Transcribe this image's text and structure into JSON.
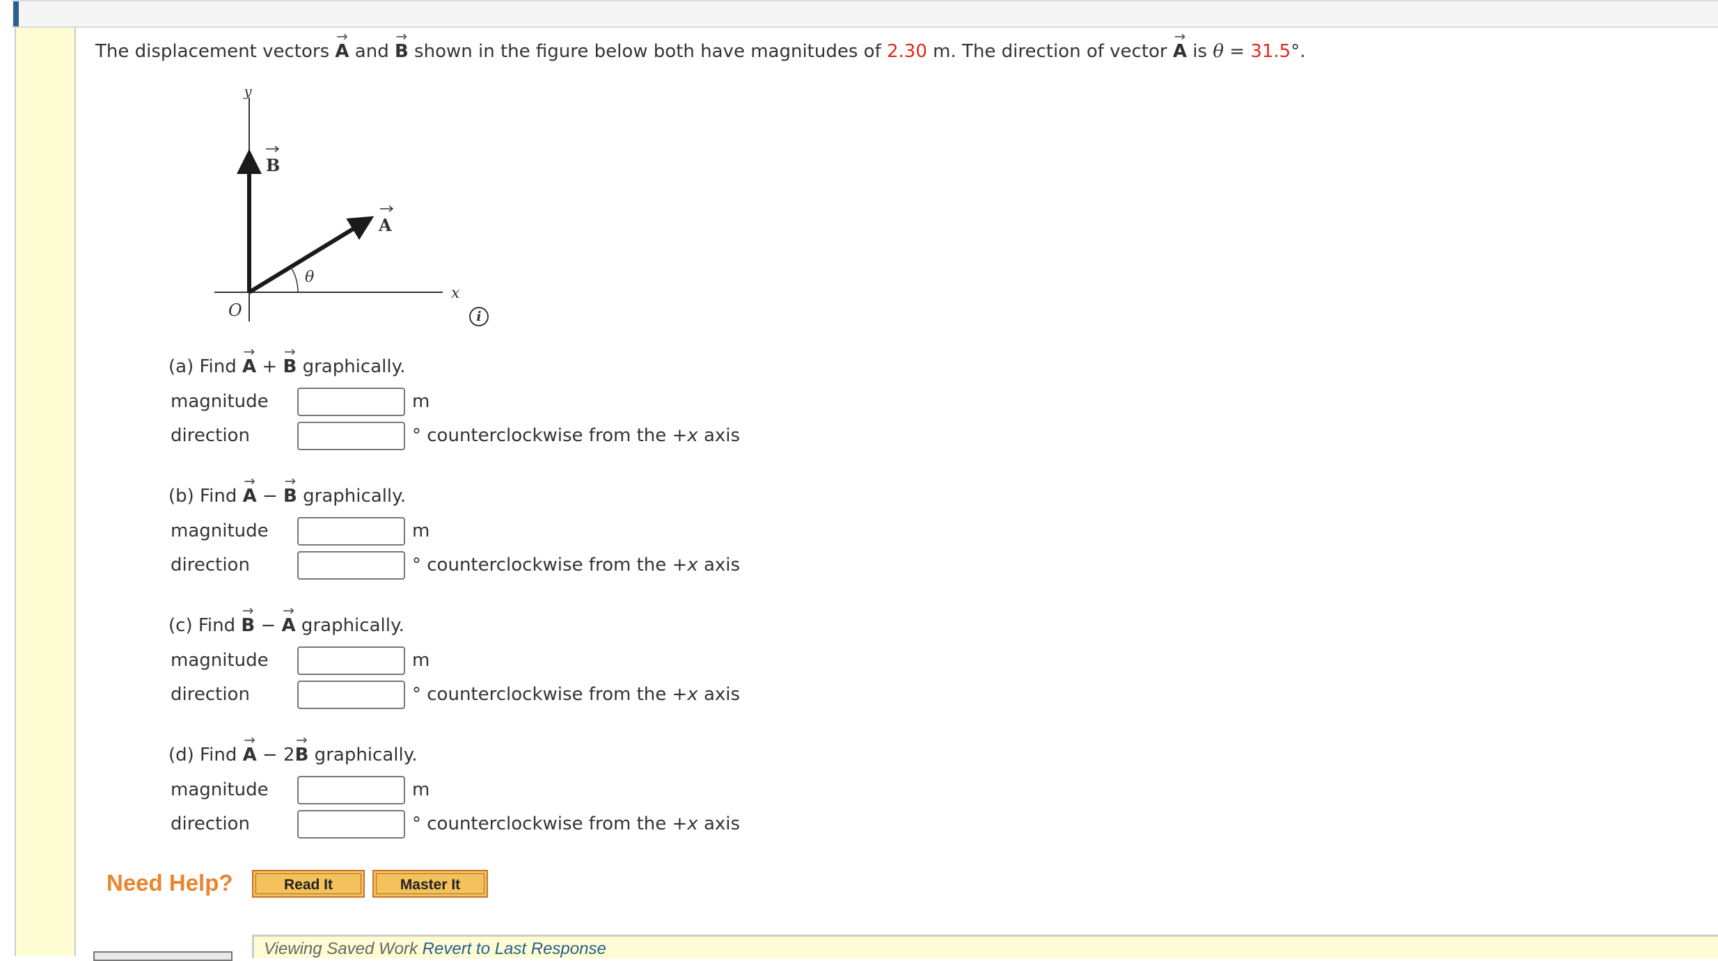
{
  "colors": {
    "accent_strip": "#2a5f92",
    "highlight_value": "#e0281e",
    "need_help": "#e8852e",
    "link": "#245f8f"
  },
  "problem": {
    "intro_part1": "The displacement vectors ",
    "vec_a": "A",
    "intro_and": " and ",
    "vec_b": "B",
    "intro_part2": " shown in the figure below both have magnitudes of ",
    "magnitude_value": "2.30",
    "intro_part3": " m. The direction of vector ",
    "intro_part4": " is ",
    "theta_symbol": "θ",
    "equals": " = ",
    "angle_value": "31.5",
    "intro_end": "°."
  },
  "figure": {
    "y_label": "y",
    "x_label": "x",
    "origin_label": "O",
    "vector_b_label": "B",
    "vector_a_label": "A",
    "angle_label": "θ",
    "info_icon": "i"
  },
  "sections": [
    {
      "prefix": "(a) Find ",
      "v1": "A",
      "op": " + ",
      "coef": "",
      "v2": "B",
      "suffix": " graphically."
    },
    {
      "prefix": "(b) Find ",
      "v1": "A",
      "op": " − ",
      "coef": "",
      "v2": "B",
      "suffix": " graphically."
    },
    {
      "prefix": "(c) Find ",
      "v1": "B",
      "op": " − ",
      "coef": "",
      "v2": "A",
      "suffix": " graphically."
    },
    {
      "prefix": "(d) Find ",
      "v1": "A",
      "op": " − ",
      "coef": "2",
      "v2": "B",
      "suffix": " graphically."
    }
  ],
  "fields": {
    "magnitude_label": "magnitude",
    "direction_label": "direction",
    "magnitude_unit": "m",
    "direction_unit_pre": "° counterclockwise from the +",
    "direction_unit_x": "x",
    "direction_unit_post": " axis",
    "magnitude_value": "",
    "direction_value": ""
  },
  "help": {
    "label": "Need Help?",
    "read_it": "Read It",
    "master_it": "Master It"
  },
  "footer": {
    "status": "Viewing Saved Work ",
    "revert_link": "Revert to Last Response"
  }
}
